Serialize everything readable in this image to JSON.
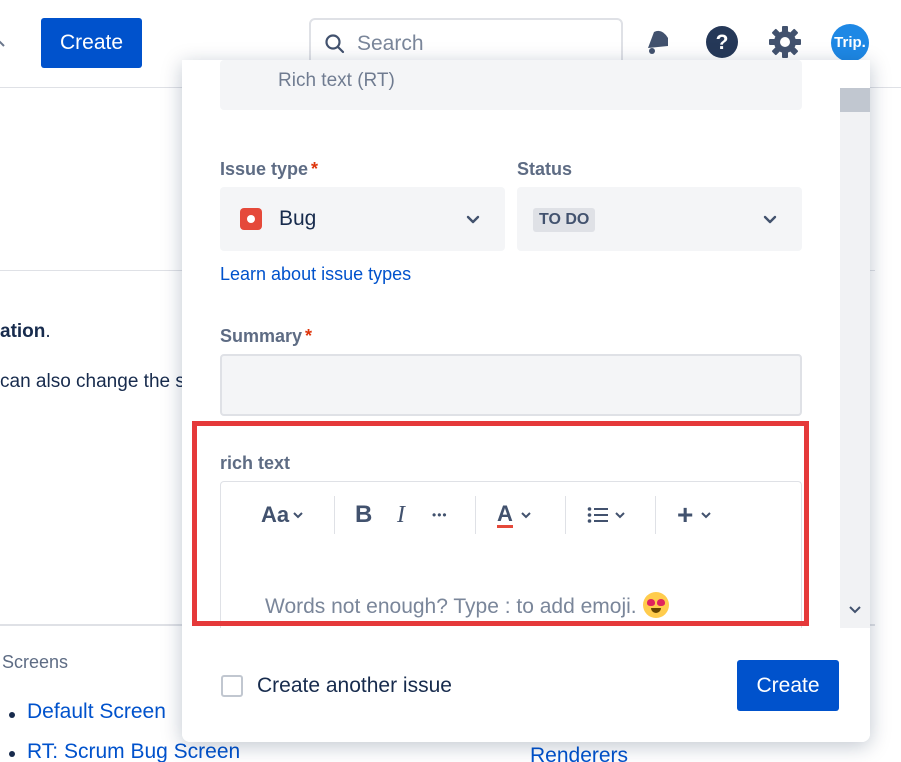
{
  "topnav": {
    "create_label": "Create",
    "search_placeholder": "Search",
    "avatar_initials": "Trip."
  },
  "background": {
    "bold_text": "ation",
    "bold_suffix": ".",
    "body_text": "can also change the s",
    "screens_label": "Screens",
    "links": [
      "Default Screen",
      "RT: Scrum Bug Screen",
      "Renderers"
    ]
  },
  "modal": {
    "previous_field_text": "Rich text (RT)",
    "issue_type": {
      "label": "Issue type",
      "required_mark": "*",
      "value": "Bug"
    },
    "status": {
      "label": "Status",
      "value": "TO DO"
    },
    "learn_link": "Learn about issue types",
    "summary": {
      "label": "Summary",
      "required_mark": "*",
      "value": ""
    },
    "rich_text": {
      "label": "rich text",
      "toolbar": {
        "text_style": "Aa",
        "bold": "B",
        "italic": "I",
        "more": "•••",
        "text_color": "A",
        "list": "list",
        "insert": "+"
      },
      "placeholder": "Words not enough? Type : to add emoji."
    },
    "footer": {
      "create_another_label": "Create another issue",
      "create_label": "Create"
    }
  },
  "colors": {
    "brand": "#0052cc",
    "highlight": "#e5393a",
    "bug": "#e5493a"
  }
}
